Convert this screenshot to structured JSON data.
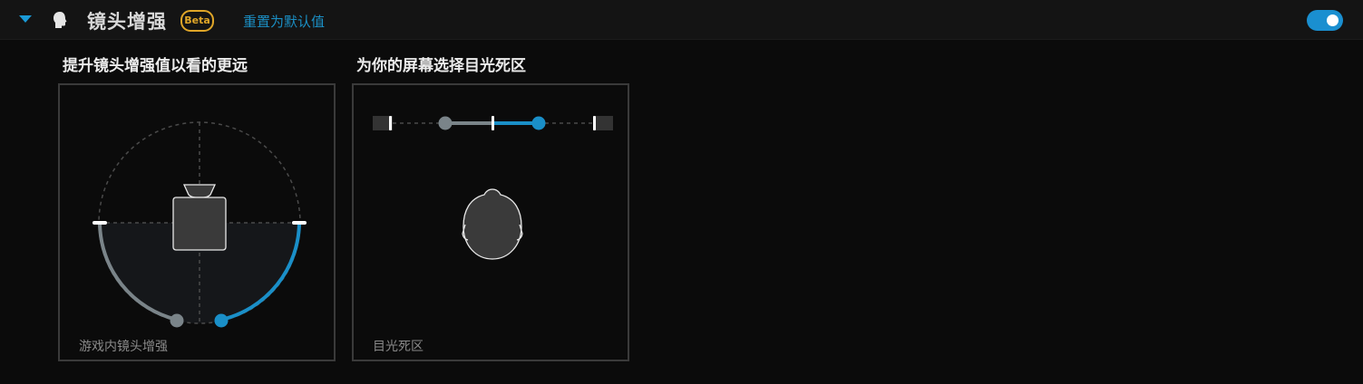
{
  "header": {
    "title": "镜头增强",
    "badge": "Beta",
    "reset_link": "重置为默认值",
    "toggle_on": true,
    "accent_color": "#1a9ad6",
    "badge_color": "#e0a628"
  },
  "icons": {
    "collapse": "caret-down-icon",
    "feature": "head-icon"
  },
  "zoom_panel": {
    "heading": "提升镜头增强值以看的更远",
    "caption": "游戏内镜头增强"
  },
  "deadzone_panel": {
    "heading": "为你的屏幕选择目光死区",
    "caption": "目光死区"
  }
}
